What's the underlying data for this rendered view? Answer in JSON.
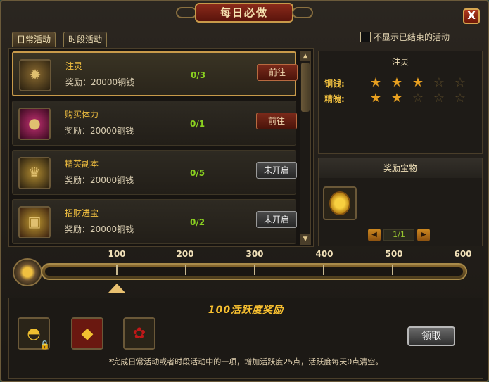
{
  "window": {
    "title": "每日必做",
    "close_label": "X"
  },
  "tabs": [
    {
      "label": "日常活动"
    },
    {
      "label": "时段活动"
    }
  ],
  "hide_finished_label": "不显示已结束的活动",
  "activities": [
    {
      "name": "注灵",
      "reward": "奖励：20000铜钱",
      "progress": "0/3",
      "button": "前往",
      "icon": "spirit-beast-icon"
    },
    {
      "name": "购买体力",
      "reward": "奖励：20000铜钱",
      "progress": "0/1",
      "button": "前往",
      "icon": "stamina-orb-icon"
    },
    {
      "name": "精英副本",
      "reward": "奖励：20000铜钱",
      "progress": "0/5",
      "button": "未开启",
      "icon": "elite-dungeon-icon"
    },
    {
      "name": "招财进宝",
      "reward": "奖励：20000铜钱",
      "progress": "0/2",
      "button": "未开启",
      "icon": "treasure-chest-icon"
    }
  ],
  "detail": {
    "title": "注灵",
    "ratings": [
      {
        "label": "铜钱:",
        "stars": 3,
        "max": 5
      },
      {
        "label": "精魄:",
        "stars": 2,
        "max": 5
      }
    ]
  },
  "rewards": {
    "title": "奖励宝物",
    "page": "1/1",
    "item_icon": "gold-coin-icon"
  },
  "activity_bar": {
    "milestones": [
      "100",
      "200",
      "300",
      "400",
      "500",
      "600"
    ],
    "progress": 0,
    "selected": "100"
  },
  "bonus": {
    "title": "100活跃度奖励",
    "items": [
      "gold-ingot-icon",
      "red-envelope-icon",
      "rose-icon"
    ],
    "claim_label": "领取",
    "note": "*完成日常活动或者时段活动中的一项，增加活跃度25点，活跃度每天0点清空。"
  }
}
